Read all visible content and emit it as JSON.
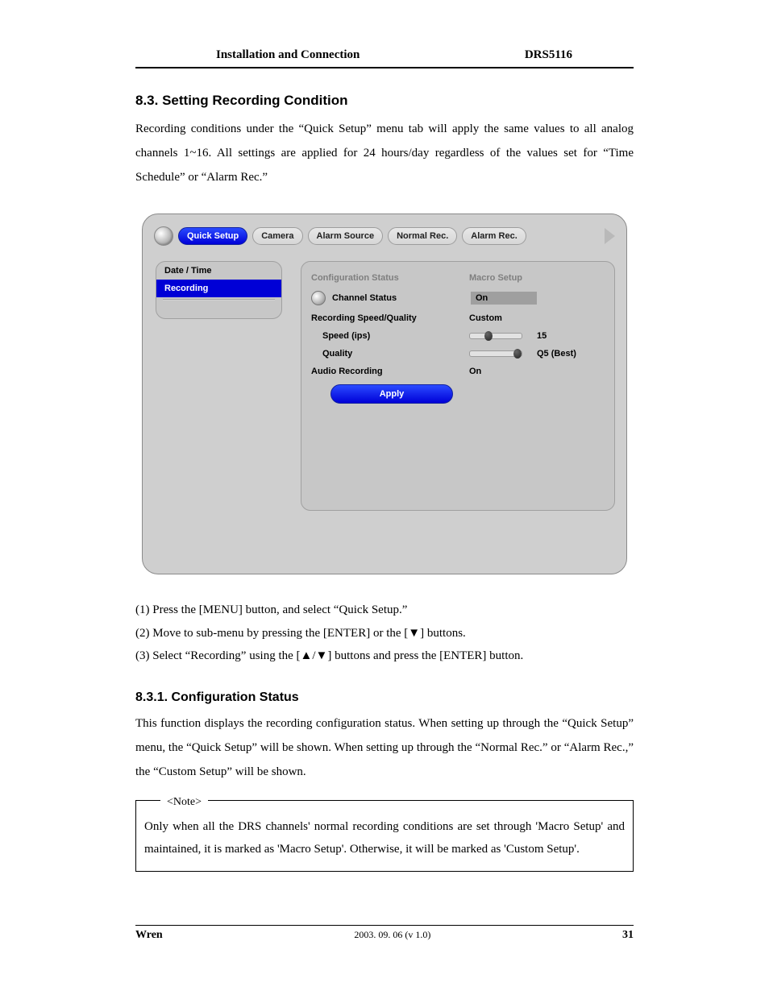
{
  "header": {
    "left": "Installation and Connection",
    "right": "DRS5116"
  },
  "section": {
    "number_title": "8.3.  Setting Recording Condition",
    "para": "Recording conditions under the “Quick Setup” menu tab will apply the same values to all analog channels 1~16.   All settings are applied for 24 hours/day regardless of the values set for “Time Schedule” or “Alarm Rec.”"
  },
  "ui": {
    "tabs": [
      "Quick Setup",
      "Camera",
      "Alarm Source",
      "Normal Rec.",
      "Alarm Rec."
    ],
    "sidebar": {
      "items": [
        "Date / Time",
        "Recording"
      ],
      "selected": 1
    },
    "rows": {
      "config_status_label": "Configuration Status",
      "macro_setup_label": "Macro Setup",
      "channel_status_label": "Channel Status",
      "channel_status_value": "On",
      "rec_speed_quality_label": "Recording Speed/Quality",
      "rec_speed_quality_value": "Custom",
      "speed_label": "Speed (ips)",
      "speed_value": "15",
      "quality_label": "Quality",
      "quality_value": "Q5 (Best)",
      "audio_label": "Audio Recording",
      "audio_value": "On",
      "apply_label": "Apply"
    }
  },
  "steps": {
    "s1": "(1)  Press the [MENU] button, and select “Quick Setup.”",
    "s2": "(2)  Move to sub-menu by pressing the [ENTER] or the [▼] buttons.",
    "s3": "(3)  Select “Recording” using the [▲/▼] buttons and press the [ENTER] button."
  },
  "subsection": {
    "title": "8.3.1.  Configuration Status",
    "para": "This function displays the recording configuration status.   When setting up through the “Quick Setup” menu, the “Quick Setup” will be shown.   When setting up through the “Normal Rec.” or “Alarm Rec.,” the “Custom Setup” will be shown."
  },
  "note": {
    "label": "<Note>",
    "text": "Only when all the DRS channels' normal recording conditions are set through 'Macro Setup' and maintained, it is marked as 'Macro Setup'.   Otherwise, it will be marked as 'Custom Setup'."
  },
  "footer": {
    "brand": "Wren",
    "version": "2003. 09. 06 (v 1.0)",
    "page": "31"
  }
}
